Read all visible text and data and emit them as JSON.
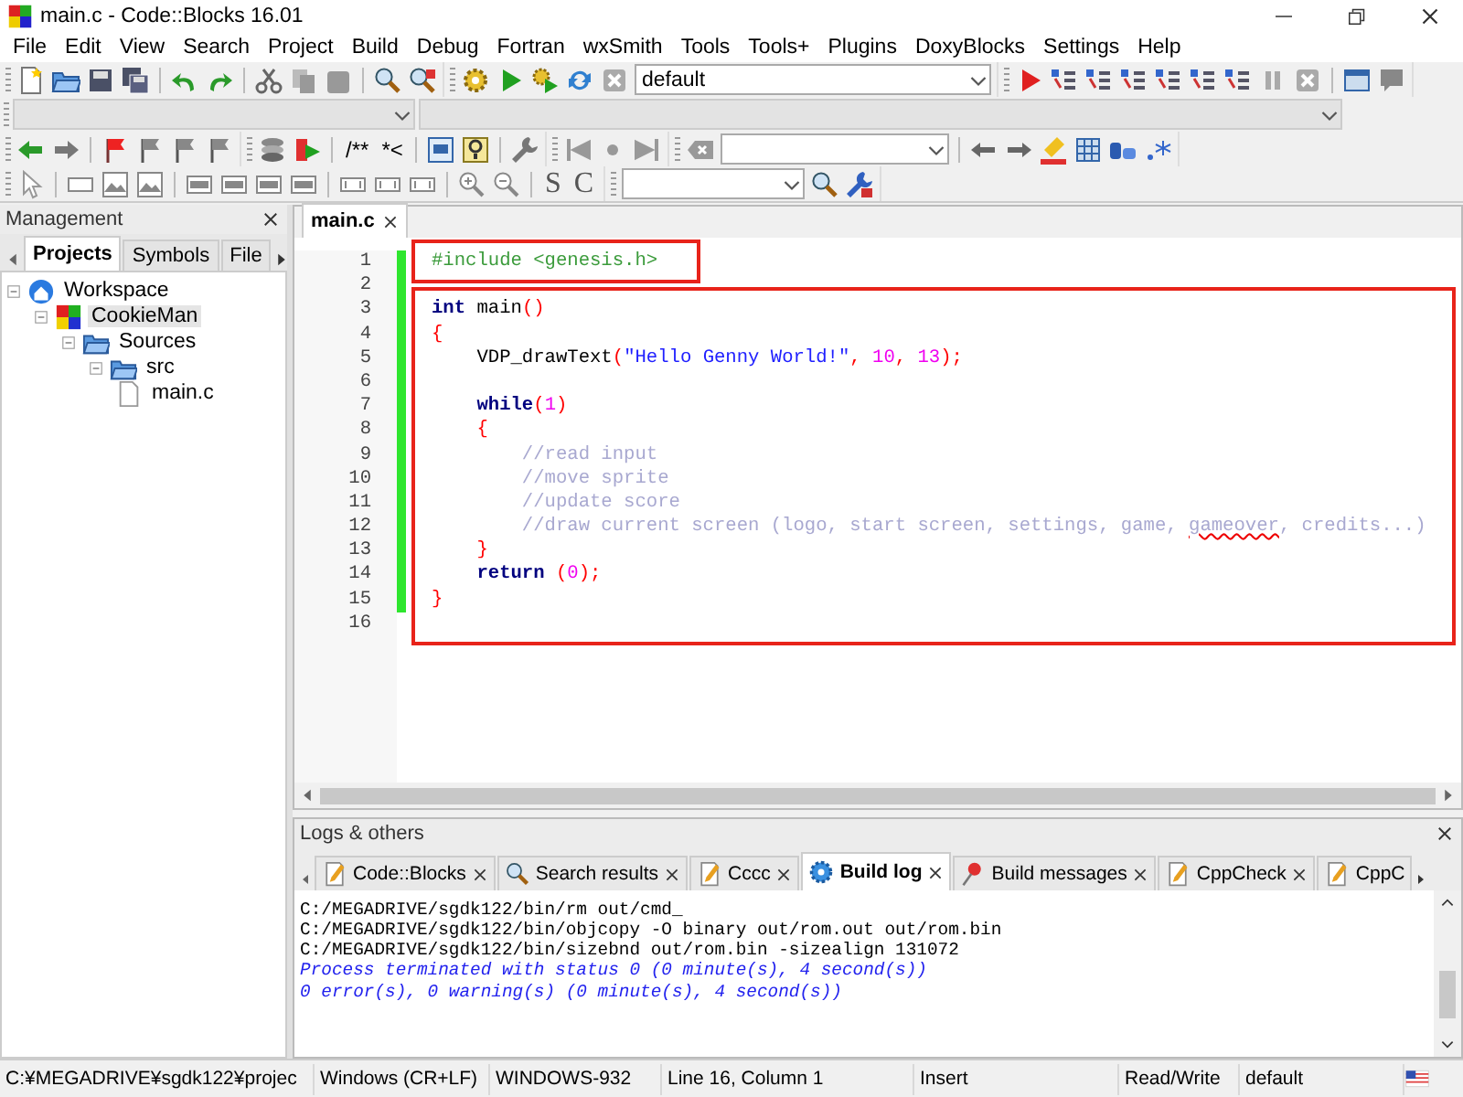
{
  "window": {
    "title": "main.c - Code::Blocks 16.01"
  },
  "menu": [
    "File",
    "Edit",
    "View",
    "Search",
    "Project",
    "Build",
    "Debug",
    "Fortran",
    "wxSmith",
    "Tools",
    "Tools+",
    "Plugins",
    "DoxyBlocks",
    "Settings",
    "Help"
  ],
  "toolbar": {
    "build_target": "default",
    "comment_buttons": [
      "/**",
      "*<"
    ],
    "style_buttons": [
      "S",
      "C"
    ]
  },
  "management": {
    "title": "Management",
    "tabs": [
      {
        "label": "Projects",
        "selected": true
      },
      {
        "label": "Symbols",
        "selected": false
      },
      {
        "label": "File",
        "selected": false
      }
    ],
    "tree": [
      {
        "label": "Workspace",
        "kind": "workspace",
        "selected": false,
        "expanded": true,
        "children": [
          {
            "label": "CookieMan",
            "kind": "project",
            "selected": true,
            "expanded": true,
            "children": [
              {
                "label": "Sources",
                "kind": "folder",
                "selected": false,
                "expanded": true,
                "children": [
                  {
                    "label": "src",
                    "kind": "folder",
                    "selected": false,
                    "expanded": true,
                    "children": [
                      {
                        "label": "main.c",
                        "kind": "file",
                        "selected": false
                      }
                    ]
                  }
                ]
              }
            ]
          }
        ]
      }
    ]
  },
  "editor": {
    "tabs": [
      {
        "label": "main.c",
        "selected": true
      }
    ],
    "blocks": [
      {
        "kind": "boxed-text",
        "lines": [
          {
            "number": "1",
            "changed": true,
            "tokens": [
              {
                "kind": "preprocessor",
                "text": "#include <genesis.h>"
              }
            ]
          }
        ]
      },
      {
        "kind": "plain",
        "lines": [
          {
            "number": "2",
            "changed": true
          }
        ]
      },
      {
        "kind": "boxed-area",
        "lines": [
          {
            "number": "3",
            "changed": true,
            "tokens": [
              {
                "kind": "keyword",
                "text": "int"
              },
              {
                "kind": "identifier",
                "text": " main"
              },
              {
                "kind": "operator",
                "text": "()"
              }
            ]
          },
          {
            "number": "4",
            "changed": true,
            "tokens": [
              {
                "kind": "operator",
                "text": "{"
              }
            ]
          },
          {
            "number": "5",
            "changed": true,
            "tokens": [
              {
                "kind": "identifier",
                "text": "    VDP_drawText"
              },
              {
                "kind": "operator",
                "text": "("
              },
              {
                "kind": "string",
                "text": "\"Hello Genny World!\""
              },
              {
                "kind": "operator",
                "text": ", "
              },
              {
                "kind": "number",
                "text": "10"
              },
              {
                "kind": "operator",
                "text": ", "
              },
              {
                "kind": "number",
                "text": "13"
              },
              {
                "kind": "operator",
                "text": ");"
              }
            ]
          },
          {
            "number": "6",
            "changed": true
          },
          {
            "number": "7",
            "changed": true,
            "tokens": [
              {
                "kind": "keyword",
                "text": "    while"
              },
              {
                "kind": "operator",
                "text": "("
              },
              {
                "kind": "number",
                "text": "1"
              },
              {
                "kind": "operator",
                "text": ")"
              }
            ]
          },
          {
            "number": "8",
            "changed": true,
            "tokens": [
              {
                "kind": "operator",
                "text": "    {"
              }
            ]
          },
          {
            "number": "9",
            "changed": true,
            "tokens": [
              {
                "kind": "comment",
                "text": "        //read input"
              }
            ]
          },
          {
            "number": "10",
            "changed": true,
            "tokens": [
              {
                "kind": "comment",
                "text": "        //move sprite"
              }
            ]
          },
          {
            "number": "11",
            "changed": true,
            "tokens": [
              {
                "kind": "comment",
                "text": "        //update score"
              }
            ]
          },
          {
            "number": "12",
            "changed": true,
            "tokens": [
              {
                "kind": "comment",
                "text": "        //draw current screen (logo, start screen, settings, game, "
              },
              {
                "kind": "misspelled",
                "text": "gameover"
              },
              {
                "kind": "comment",
                "text": ", credits...)"
              }
            ]
          },
          {
            "number": "13",
            "changed": true,
            "tokens": [
              {
                "kind": "operator",
                "text": "    }"
              }
            ]
          },
          {
            "number": "14",
            "changed": true,
            "tokens": [
              {
                "kind": "keyword",
                "text": "    return"
              },
              {
                "kind": "operator",
                "text": " ("
              },
              {
                "kind": "number",
                "text": "0"
              },
              {
                "kind": "operator",
                "text": ");"
              }
            ]
          },
          {
            "number": "15",
            "changed": true,
            "tokens": [
              {
                "kind": "operator",
                "text": "}"
              }
            ]
          },
          {
            "number": "16",
            "changed": false
          }
        ]
      }
    ]
  },
  "logs": {
    "title": "Logs & others",
    "tabs": [
      {
        "label": "Code::Blocks",
        "selected": false
      },
      {
        "label": "Search results",
        "selected": false
      },
      {
        "label": "Cccc",
        "selected": false
      },
      {
        "label": "Build log",
        "selected": true
      },
      {
        "label": "Build messages",
        "selected": false
      },
      {
        "label": "CppCheck",
        "selected": false
      },
      {
        "label": "CppC",
        "selected": false
      }
    ],
    "lines": [
      {
        "kind": "plain",
        "text": "C:/MEGADRIVE/sgdk122/bin/rm out/cmd_"
      },
      {
        "kind": "plain",
        "text": "C:/MEGADRIVE/sgdk122/bin/objcopy -O binary out/rom.out out/rom.bin"
      },
      {
        "kind": "plain",
        "text": "C:/MEGADRIVE/sgdk122/bin/sizebnd out/rom.bin -sizealign 131072"
      },
      {
        "kind": "info",
        "text": "Process terminated with status 0 (0 minute(s), 4 second(s))"
      },
      {
        "kind": "info",
        "text": "0 error(s), 0 warning(s) (0 minute(s), 4 second(s))"
      }
    ]
  },
  "status_bar": [
    "C:¥MEGADRIVE¥sgdk122¥projec",
    "Windows (CR+LF)",
    "WINDOWS-932",
    "Line 16, Column 1",
    "Insert",
    "Read/Write",
    "default"
  ]
}
